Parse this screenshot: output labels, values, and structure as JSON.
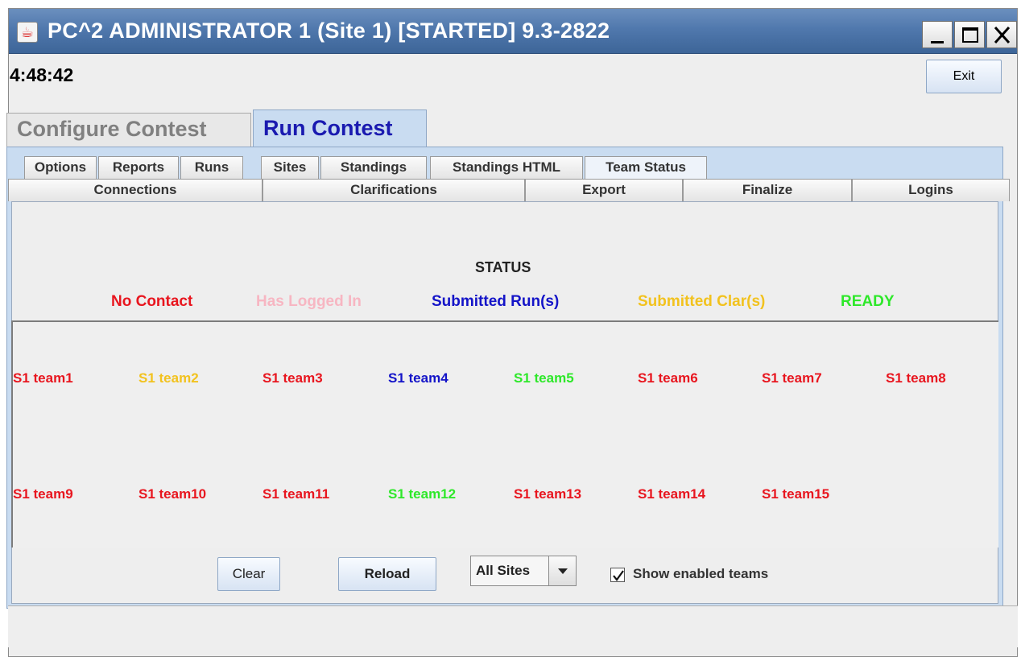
{
  "window": {
    "title": "PC^2 ADMINISTRATOR 1 (Site 1) [STARTED] 9.3-2822",
    "app_icon": "java-cup-icon",
    "controls": [
      "minimize-icon",
      "maximize-icon",
      "close-icon"
    ]
  },
  "header": {
    "clock": "4:48:42",
    "exit_label": "Exit"
  },
  "main_tabs": [
    {
      "label": "Configure Contest",
      "active": false
    },
    {
      "label": "Run Contest",
      "active": true
    }
  ],
  "sub_tabs_row1": [
    "Options",
    "Reports",
    "Runs",
    "Sites",
    "Standings",
    "Standings HTML",
    "Team Status"
  ],
  "sub_tabs_row2": [
    "Connections",
    "Clarifications",
    "Export",
    "Finalize",
    "Logins"
  ],
  "status": {
    "title": "STATUS",
    "legend": [
      {
        "label": "No Contact",
        "color": "#e8161f"
      },
      {
        "label": "Has Logged In",
        "color": "#f7b6c2"
      },
      {
        "label": "Submitted Run(s)",
        "color": "#1414c8"
      },
      {
        "label": "Submitted Clar(s)",
        "color": "#f2c21e"
      },
      {
        "label": "READY",
        "color": "#2ee82a"
      }
    ]
  },
  "teams_row1": [
    {
      "label": "S1 team1",
      "color": "#e8161f"
    },
    {
      "label": "S1 team2",
      "color": "#f2c21e"
    },
    {
      "label": "S1 team3",
      "color": "#e8161f"
    },
    {
      "label": "S1 team4",
      "color": "#1414c8"
    },
    {
      "label": "S1 team5",
      "color": "#2ee82a"
    },
    {
      "label": "S1 team6",
      "color": "#e8161f"
    },
    {
      "label": "S1 team7",
      "color": "#e8161f"
    },
    {
      "label": "S1 team8",
      "color": "#e8161f"
    }
  ],
  "teams_row2": [
    {
      "label": "S1 team9",
      "color": "#e8161f"
    },
    {
      "label": "S1 team10",
      "color": "#e8161f"
    },
    {
      "label": "S1 team11",
      "color": "#e8161f"
    },
    {
      "label": "S1 team12",
      "color": "#2ee82a"
    },
    {
      "label": "S1 team13",
      "color": "#e8161f"
    },
    {
      "label": "S1 team14",
      "color": "#e8161f"
    },
    {
      "label": "S1 team15",
      "color": "#e8161f"
    }
  ],
  "controls": {
    "clear_label": "Clear",
    "reload_label": "Reload",
    "site_selected": "All Sites",
    "show_enabled_checked": true,
    "show_enabled_label": "Show enabled teams"
  }
}
